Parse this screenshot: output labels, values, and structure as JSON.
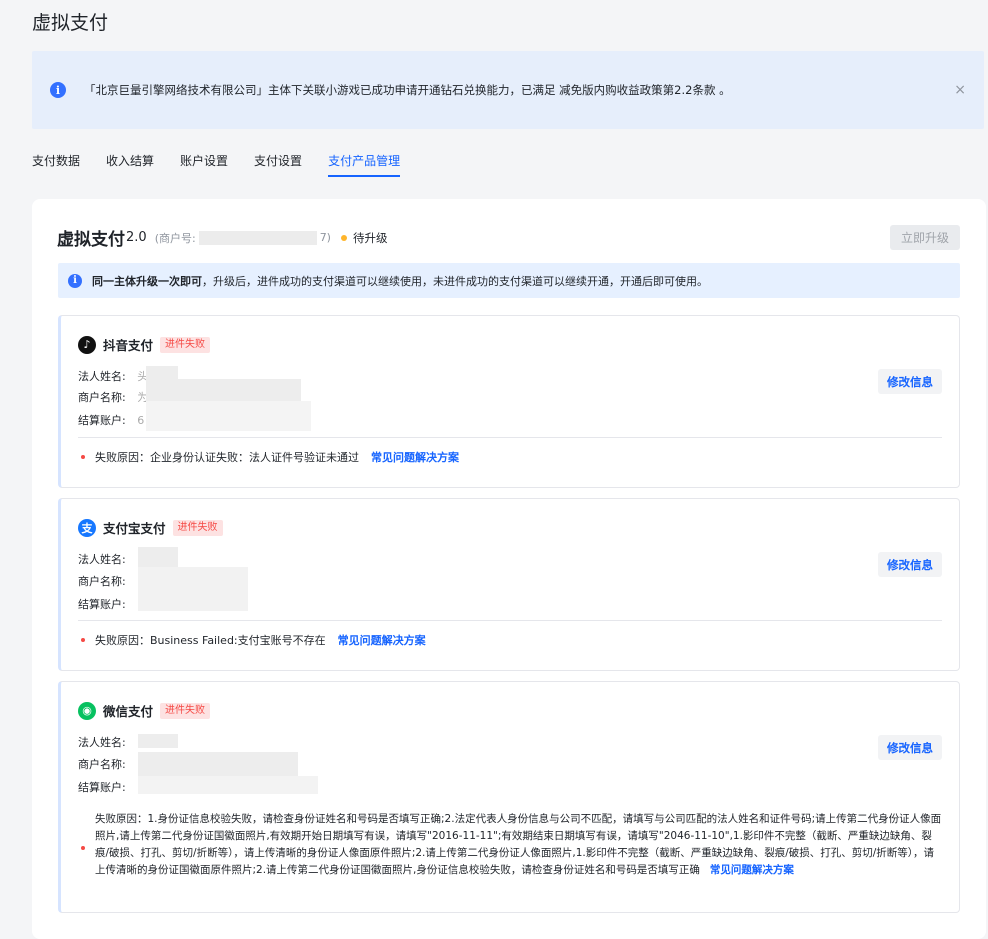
{
  "page": {
    "title": "虚拟支付"
  },
  "notice": {
    "text": "「北京巨量引擎网络技术有限公司」主体下关联小游戏已成功申请开通钻石兑换能力，已满足 减免版内购收益政策第2.2条款 。",
    "close": "×"
  },
  "tabs": [
    "支付数据",
    "收入结算",
    "账户设置",
    "支付设置",
    "支付产品管理"
  ],
  "active_tab": "支付产品管理",
  "card": {
    "title": "虚拟支付",
    "version": "2.0",
    "merchant_prefix": "(商户号:",
    "merchant_suffix": "7)",
    "status": "待升级",
    "upgrade_label": "立即升级",
    "tip_bold": "同一主体升级一次即可",
    "tip_text": "，升级后，进件成功的支付渠道可以继续使用，未进件成功的支付渠道可以继续开通，开通后即可使用。"
  },
  "labels": {
    "legal_name": "法人姓名:",
    "merchant_name": "商户名称:",
    "account": "结算账户:",
    "edit": "修改信息",
    "faq": "常见问题解决方案",
    "fail_tag": "进件失败"
  },
  "providers": [
    {
      "name": "抖音支付",
      "icon": "douyin-icon",
      "legal_prefix": "头",
      "merchant_prefix": "为",
      "account_prefix": "6",
      "reason": "失败原因：企业身份认证失败：法人证件号验证未通过"
    },
    {
      "name": "支付宝支付",
      "icon": "alipay-icon",
      "reason": "失败原因：Business Failed:支付宝账号不存在"
    },
    {
      "name": "微信支付",
      "icon": "wechat-icon",
      "reason": "失败原因：1.身份证信息校验失败，请检查身份证姓名和号码是否填写正确;2.法定代表人身份信息与公司不匹配，请填写与公司匹配的法人姓名和证件号码;请上传第二代身份证人像面照片,请上传第二代身份证国徽面照片,有效期开始日期填写有误，请填写\"2016-11-11\";有效期结束日期填写有误，请填写\"2046-11-10\",1.影印件不完整（截断、严重缺边缺角、裂痕/破损、打孔、剪切/折断等），请上传清晰的身份证人像面原件照片;2.请上传第二代身份证人像面照片,1.影印件不完整（截断、严重缺边缺角、裂痕/破损、打孔、剪切/折断等），请上传清晰的身份证国徽面原件照片;2.请上传第二代身份证国徽面照片,身份证信息校验失败，请检查身份证姓名和号码是否填写正确"
    }
  ],
  "colors": {
    "accent": "#1664ff",
    "fail": "#f54a45",
    "pending": "#ffb52b"
  }
}
